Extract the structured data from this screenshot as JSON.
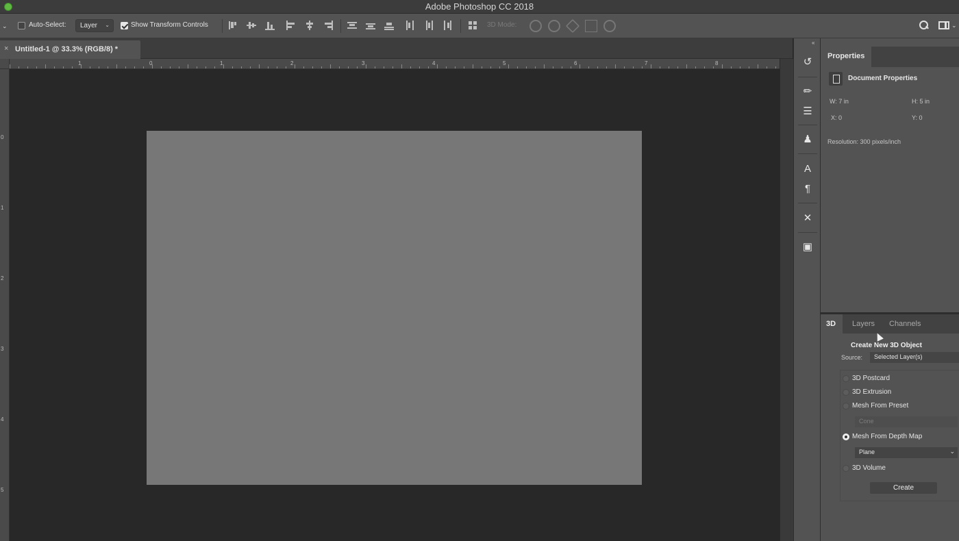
{
  "app": {
    "title": "Adobe Photoshop CC 2018"
  },
  "options_bar": {
    "tool_menu_icon": "chevron-down-icon",
    "auto_select_label": "Auto-Select:",
    "auto_select_checked": false,
    "auto_select_target": "Layer",
    "show_transform_label": "Show Transform Controls",
    "show_transform_checked": true,
    "mode_3d_label": "3D Mode:",
    "right_icons": [
      "search-icon",
      "workspace-icon"
    ]
  },
  "document": {
    "tab_title": "Untitled-1 @ 33.3% (RGB/8) *",
    "close_glyph": "×",
    "canvas_color": "#777777"
  },
  "rulers": {
    "horizontal": [
      "1",
      "0",
      "1",
      "2",
      "3",
      "4",
      "5",
      "6",
      "7",
      "8"
    ],
    "vertical": [
      "0",
      "1",
      "2",
      "3",
      "4",
      "5"
    ]
  },
  "properties_panel": {
    "tab": "Properties",
    "section_title": "Document Properties",
    "width": "W:  7 in",
    "height": "H:  5 in",
    "x": "X:  0",
    "y": "Y:  0",
    "resolution": "Resolution: 300 pixels/inch"
  },
  "bottom_panel": {
    "tabs": [
      {
        "label": "3D",
        "active": true
      },
      {
        "label": "Layers",
        "active": false
      },
      {
        "label": "Channels",
        "active": false
      }
    ],
    "heading": "Create New 3D Object",
    "source_label": "Source:",
    "source_value": "Selected Layer(s)",
    "options": [
      {
        "label": "3D Postcard",
        "selected": false
      },
      {
        "label": "3D Extrusion",
        "selected": false
      },
      {
        "label": "Mesh From Preset",
        "selected": false
      },
      {
        "label": "Mesh From Depth Map",
        "selected": true
      },
      {
        "label": "3D Volume",
        "selected": false
      }
    ],
    "preset_value": "Cone",
    "depth_map_value": "Plane",
    "create_label": "Create"
  }
}
